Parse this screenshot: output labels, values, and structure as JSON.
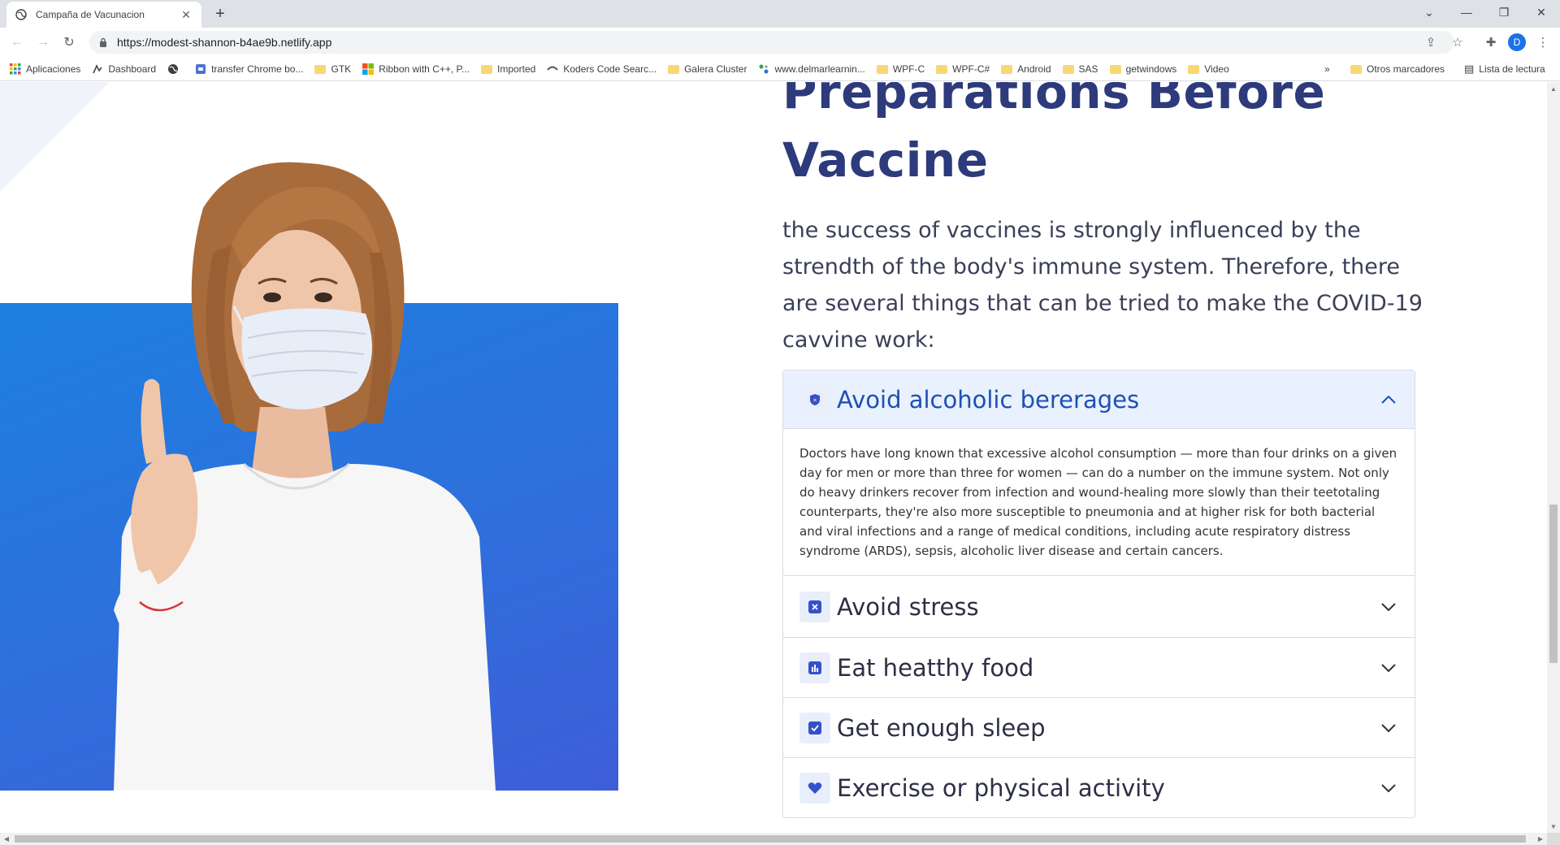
{
  "browser": {
    "tab_title": "Campaña de Vacunacion",
    "url": "https://modest-shannon-b4ae9b.netlify.app",
    "profile_initial": "D",
    "bookmarks": [
      {
        "label": "Aplicaciones",
        "icon": "apps-grid-icon"
      },
      {
        "label": "Dashboard",
        "icon": "dashboard-icon"
      },
      {
        "label": "",
        "icon": "globe-icon"
      },
      {
        "label": "transfer Chrome bo...",
        "icon": "transfer-icon"
      },
      {
        "label": "GTK",
        "icon": "folder-icon"
      },
      {
        "label": "Ribbon with C++, P...",
        "icon": "windows-logo-icon"
      },
      {
        "label": "Imported",
        "icon": "folder-icon"
      },
      {
        "label": "Koders Code Searc...",
        "icon": "koders-icon"
      },
      {
        "label": "Galera Cluster",
        "icon": "folder-icon"
      },
      {
        "label": "www.delmarlearnin...",
        "icon": "delmar-icon"
      },
      {
        "label": "WPF-C",
        "icon": "folder-icon"
      },
      {
        "label": "WPF-C#",
        "icon": "folder-icon"
      },
      {
        "label": "Android",
        "icon": "folder-icon"
      },
      {
        "label": "SAS",
        "icon": "folder-icon"
      },
      {
        "label": "getwindows",
        "icon": "folder-icon"
      },
      {
        "label": "Video",
        "icon": "folder-icon"
      }
    ],
    "more_bookmarks": "»",
    "other_bookmarks": "Otros marcadores",
    "reading_list": "Lista de lectura"
  },
  "page": {
    "title_line1": "Preparations Before",
    "title_line2": "Vaccine",
    "intro": "the success of vaccines is strongly influenced by the strendth of the body's immune system. Therefore, there are several things that can be tried to make the COVID-19 cavvine work:",
    "accordion": [
      {
        "label": "Avoid alcoholic bererages",
        "icon": "shield-icon",
        "open": true,
        "body": "Doctors have long known that excessive alcohol consumption — more than four drinks on a given day for men or more than three for women — can do a number on the immune system. Not only do heavy drinkers recover from infection and wound-healing more slowly than their teetotaling counterparts, they're also more susceptible to pneumonia and at higher risk for both bacterial and viral infections and a range of medical conditions, including acute respiratory distress syndrome (ARDS), sepsis, alcoholic liver disease and certain cancers."
      },
      {
        "label": "Avoid stress",
        "icon": "x-square-icon",
        "open": false
      },
      {
        "label": "Eat heatthy food",
        "icon": "bar-chart-icon",
        "open": false
      },
      {
        "label": "Get enough sleep",
        "icon": "check-square-icon",
        "open": false
      },
      {
        "label": "Exercise or physical activity",
        "icon": "heart-icon",
        "open": false
      }
    ]
  },
  "colors": {
    "title": "#2d3a7b",
    "accent": "#1f50b3",
    "hero_blue": "#2f6fdc",
    "open_header_bg": "#e8f1fd"
  }
}
